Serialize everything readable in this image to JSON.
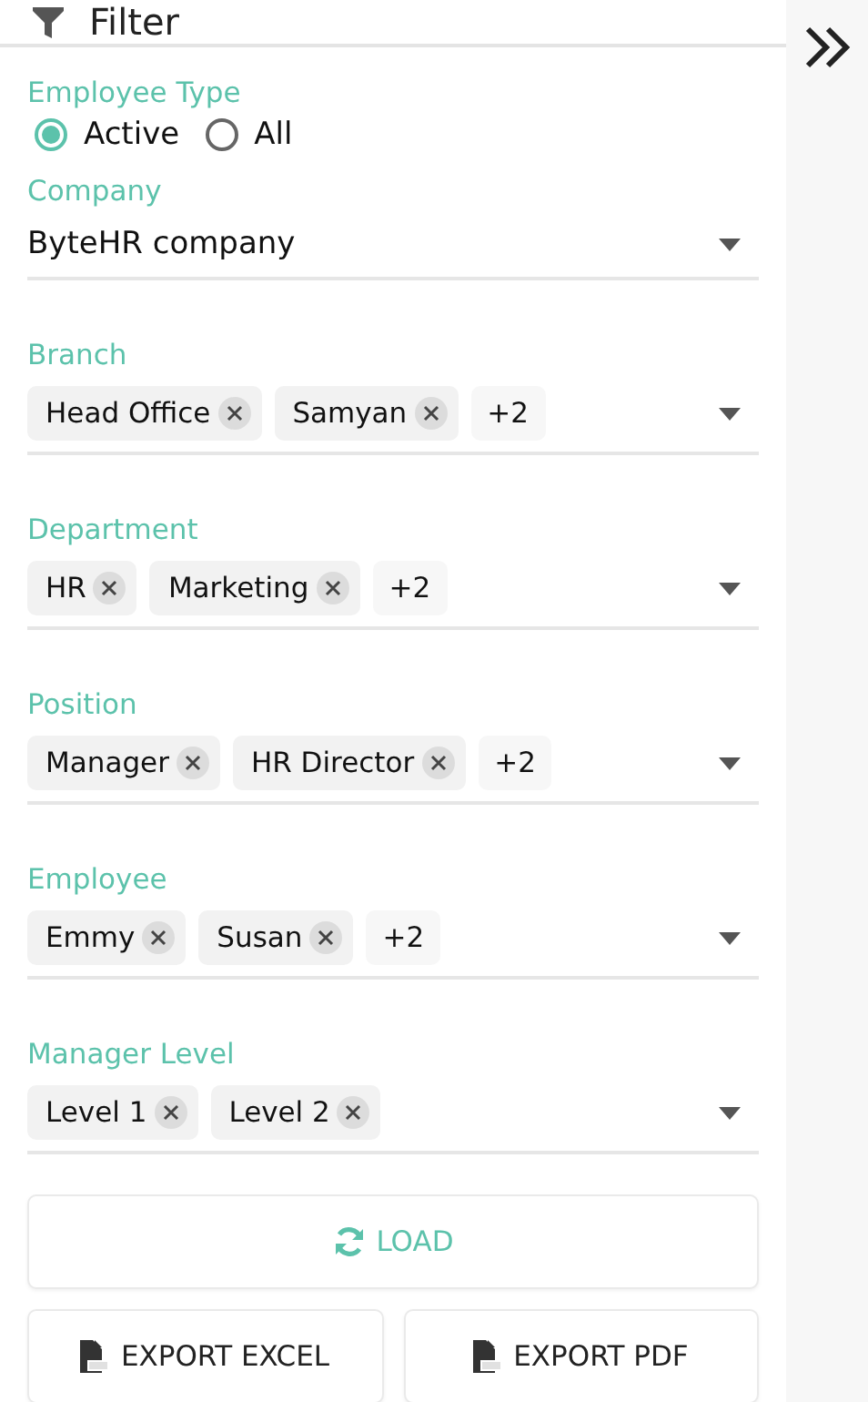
{
  "header": {
    "title": "Filter"
  },
  "employee_type": {
    "label": "Employee Type",
    "options": [
      {
        "label": "Active",
        "selected": true
      },
      {
        "label": "All",
        "selected": false
      }
    ]
  },
  "fields": [
    {
      "kind": "select",
      "label": "Company",
      "value": "ByteHR company"
    },
    {
      "kind": "multi",
      "label": "Branch",
      "chips": [
        "Head Office",
        "Samyan"
      ],
      "more": "+2"
    },
    {
      "kind": "multi",
      "label": "Department",
      "chips": [
        "HR",
        "Marketing"
      ],
      "more": "+2"
    },
    {
      "kind": "multi",
      "label": "Position",
      "chips": [
        "Manager",
        "HR Director"
      ],
      "more": "+2"
    },
    {
      "kind": "multi",
      "label": "Employee",
      "chips": [
        "Emmy",
        "Susan"
      ],
      "more": "+2"
    },
    {
      "kind": "multi",
      "label": "Manager Level",
      "chips": [
        "Level 1",
        "Level 2"
      ]
    }
  ],
  "buttons": {
    "load": "LOAD",
    "export_excel": "EXPORT EXCEL",
    "export_pdf": "EXPORT PDF"
  }
}
